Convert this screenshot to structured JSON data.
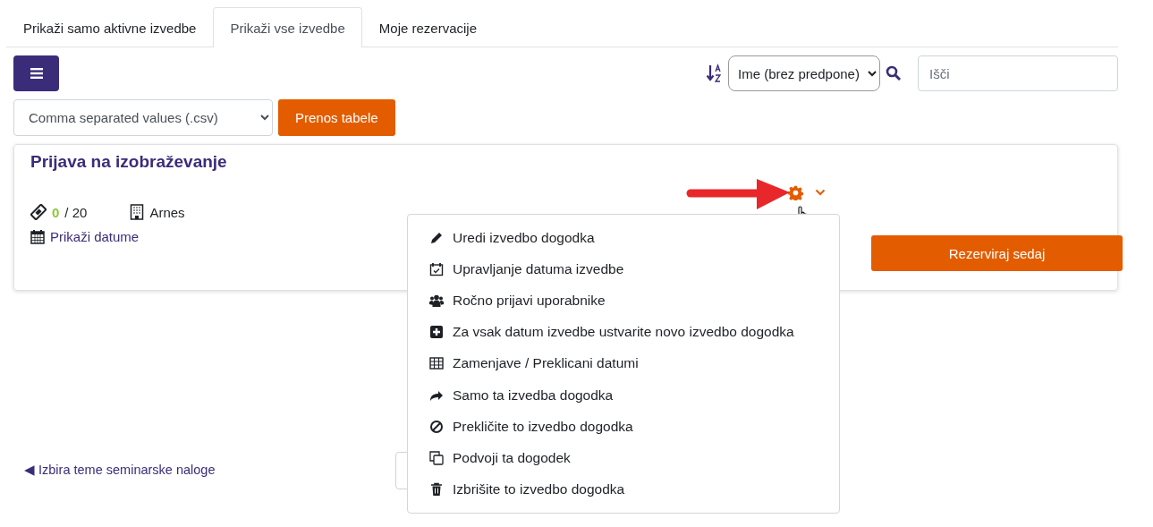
{
  "tabs": [
    {
      "label": "Prikaži samo aktivne izvedbe",
      "selected": false
    },
    {
      "label": "Prikaži vse izvedbe",
      "selected": true
    },
    {
      "label": "Moje rezervacije",
      "selected": false
    }
  ],
  "toolbar": {
    "sort_select": "Ime (brez predpone)",
    "search": {
      "placeholder": "Išči"
    }
  },
  "export": {
    "format_select": "Comma separated values (.csv)",
    "button": "Prenos tabele"
  },
  "event_card": {
    "title": "Prijava na izobraževanje",
    "booked": "0",
    "capacity": "/ 20",
    "location": "Arnes",
    "dates_link": "Prikaži datume",
    "book_button": "Rezerviraj sedaj"
  },
  "actions_menu": {
    "expanded": true,
    "items": [
      {
        "kind": "edit",
        "label": "Uredi izvedbo dogodka"
      },
      {
        "kind": "calendar",
        "label": "Upravljanje datuma izvedbe"
      },
      {
        "kind": "users",
        "label": "Ročno prijavi uporabnike"
      },
      {
        "kind": "plus",
        "label": "Za vsak datum izvedbe ustvarite novo izvedbo dogodka"
      },
      {
        "kind": "table",
        "label": "Zamenjave / Preklicani datumi"
      },
      {
        "kind": "share",
        "label": "Samo ta izvedba dogodka"
      },
      {
        "kind": "ban",
        "label": "Prekličite to izvedbo dogodka"
      },
      {
        "kind": "copy",
        "label": "Podvoji ta dogodek"
      },
      {
        "kind": "trash",
        "label": "Izbrišite to izvedbo dogodka"
      }
    ]
  },
  "back_link": "◀ Izbira teme seminarske naloge"
}
